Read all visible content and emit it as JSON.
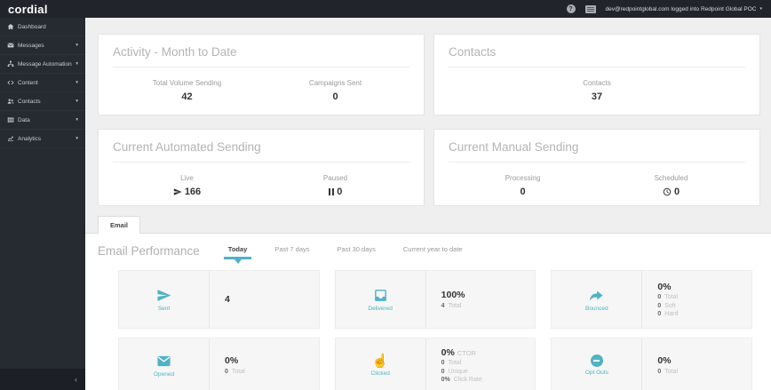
{
  "topbar": {
    "logo": "cordial",
    "help_glyph": "?",
    "session_text": "dev@redpointglobal.com logged into Redpoint Global POC",
    "caret": "▾"
  },
  "sidebar": {
    "items": [
      {
        "label": "Dashboard",
        "icon": "home"
      },
      {
        "label": "Messages",
        "icon": "envelope",
        "caret": "▾"
      },
      {
        "label": "Message Automation",
        "icon": "automation",
        "caret": "▾"
      },
      {
        "label": "Content",
        "icon": "code",
        "caret": "▾"
      },
      {
        "label": "Contacts",
        "icon": "users",
        "caret": "▾"
      },
      {
        "label": "Data",
        "icon": "table",
        "caret": "▾"
      },
      {
        "label": "Analytics",
        "icon": "chart-line",
        "caret": "▾"
      }
    ],
    "collapse_glyph": "‹"
  },
  "overview": {
    "activity": {
      "title": "Activity - Month to Date",
      "stats": [
        {
          "label": "Total Volume Sending",
          "value": "42"
        },
        {
          "label": "Campaigns Sent",
          "value": "0"
        }
      ]
    },
    "contacts": {
      "title": "Contacts",
      "stats": [
        {
          "label": "Contacts",
          "value": "37"
        }
      ]
    },
    "automated": {
      "title": "Current Automated Sending",
      "stats": [
        {
          "label": "Live",
          "value": "166",
          "icon": "paper-plane"
        },
        {
          "label": "Paused",
          "value": "0",
          "icon": "pause"
        }
      ]
    },
    "manual": {
      "title": "Current Manual Sending",
      "stats": [
        {
          "label": "Processing",
          "value": "0"
        },
        {
          "label": "Scheduled",
          "value": "0",
          "icon": "clock"
        }
      ]
    }
  },
  "email": {
    "tab_label": "Email",
    "title": "Email Performance",
    "ranges": [
      {
        "label": "Today",
        "active": true
      },
      {
        "label": "Past 7 days"
      },
      {
        "label": "Past 30 days"
      },
      {
        "label": "Current year to date"
      }
    ],
    "metrics": [
      {
        "name": "Sent",
        "icon": "paper-plane",
        "value": "4"
      },
      {
        "name": "Delivered",
        "icon": "inbox",
        "value": "100%",
        "lines": [
          {
            "num": "4",
            "label": "Total"
          }
        ]
      },
      {
        "name": "Bounced",
        "icon": "bounce-arrow",
        "value": "0%",
        "lines": [
          {
            "num": "0",
            "label": "Total"
          },
          {
            "num": "0",
            "label": "Soft"
          },
          {
            "num": "0",
            "label": "Hard"
          }
        ]
      },
      {
        "name": "Opened",
        "icon": "envelope",
        "value": "0%",
        "lines": [
          {
            "num": "0",
            "label": "Total"
          }
        ]
      },
      {
        "name": "Clicked",
        "icon": "hand-pointer",
        "value": "0%",
        "value_note": "CTOR",
        "lines": [
          {
            "num": "0",
            "label": "Total"
          },
          {
            "num": "0",
            "label": "Unique"
          },
          {
            "num": "0%",
            "label": "Click Rate"
          }
        ]
      },
      {
        "name": "Opt Outs",
        "icon": "minus-circle",
        "value": "0%",
        "lines": [
          {
            "num": "0",
            "label": "Total"
          }
        ]
      }
    ]
  },
  "colors": {
    "accent": "#4fb3c4",
    "topbar_bg": "#21252b",
    "sidebar_bg": "#262a31",
    "page_bg": "#efefef"
  }
}
